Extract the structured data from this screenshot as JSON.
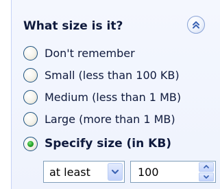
{
  "section": {
    "title": "What size is it?",
    "collapse_icon": "chevron-double-up-icon"
  },
  "size_options": [
    {
      "label": "Don't remember",
      "selected": false
    },
    {
      "label": "Small (less than 100 KB)",
      "selected": false
    },
    {
      "label": "Medium (less than 1 MB)",
      "selected": false
    },
    {
      "label": "Large (more than 1 MB)",
      "selected": false
    },
    {
      "label": "Specify size (in KB)",
      "selected": true
    }
  ],
  "size_filter": {
    "comparison_selected": "at least",
    "size_value": "100"
  },
  "colors": {
    "panel_background": "#eff3fd",
    "title_text": "#0f1a3d",
    "accent_blue": "#3d64b4",
    "radio_checked": "#29a829"
  }
}
